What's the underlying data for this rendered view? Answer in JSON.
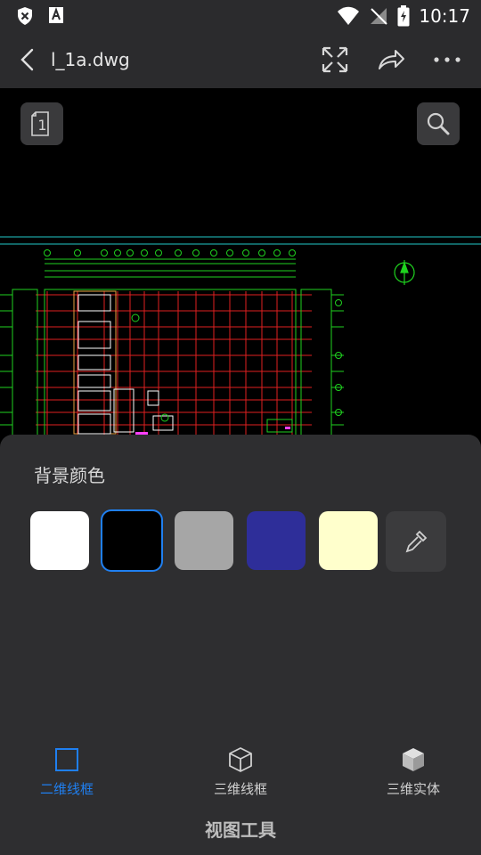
{
  "status_bar": {
    "time": "10:17"
  },
  "app_bar": {
    "title": "l_1a.dwg"
  },
  "canvas": {
    "layout_button_label": "1"
  },
  "sheet": {
    "title": "背景颜色",
    "swatches": [
      {
        "name": "white",
        "color": "#ffffff"
      },
      {
        "name": "black",
        "color": "#000000",
        "selected": true
      },
      {
        "name": "gray",
        "color": "#a6a6a6"
      },
      {
        "name": "blue",
        "color": "#2e2e99"
      },
      {
        "name": "cream",
        "color": "#ffffcc"
      }
    ],
    "modes": [
      {
        "label": "二维线框",
        "icon": "square-outline-icon",
        "active": true
      },
      {
        "label": "三维线框",
        "icon": "cube-outline-icon",
        "active": false
      },
      {
        "label": "三维实体",
        "icon": "cube-solid-icon",
        "active": false
      }
    ],
    "footer": "视图工具"
  },
  "colors": {
    "accent": "#1f7ff0",
    "sheet_bg": "#2e2e30",
    "cad_green": "#1fd21f",
    "cad_red": "#e02020",
    "cad_cyan": "#22c8c8"
  }
}
